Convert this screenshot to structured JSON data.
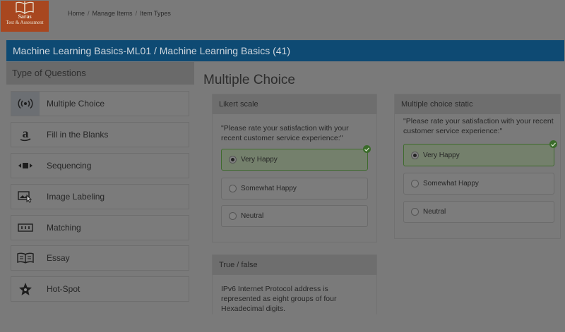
{
  "logo": {
    "line1": "Saras",
    "line2": "Test & Assessment"
  },
  "breadcrumb": [
    "Home",
    "Manage Items",
    "Item Types"
  ],
  "title_bar": "Machine Learning Basics-ML01 / Machine Learning Basics (41)",
  "sidebar": {
    "header": "Type of Questions",
    "items": [
      {
        "label": "Multiple Choice",
        "icon": "radio-signal-icon"
      },
      {
        "label": "Fill in the Blanks",
        "icon": "letter-a-icon"
      },
      {
        "label": "Sequencing",
        "icon": "sequence-arrows-icon"
      },
      {
        "label": "Image Labeling",
        "icon": "image-pointer-icon"
      },
      {
        "label": "Matching",
        "icon": "matching-icon"
      },
      {
        "label": "Essay",
        "icon": "open-book-icon"
      },
      {
        "label": "Hot-Spot",
        "icon": "hotspot-star-icon"
      }
    ]
  },
  "main": {
    "title": "Multiple Choice",
    "cards": {
      "likert": {
        "header": "Likert scale",
        "question": "\"Please rate your satisfaction with your recent customer service experience:\"",
        "options": [
          "Very Happy",
          "Somewhat Happy",
          "Neutral"
        ],
        "selected": "Very Happy"
      },
      "static": {
        "header": "Multiple choice static",
        "question": "\"Please rate your satisfaction with your recent customer service experience:\"",
        "options": [
          "Very Happy",
          "Somewhat Happy",
          "Neutral"
        ],
        "selected": "Very Happy"
      },
      "truefalse": {
        "header": "True / false",
        "question": "IPv6 Internet Protocol address is represented as eight groups of four Hexadecimal digits."
      }
    }
  },
  "colors": {
    "title_bar": "#0e4a73",
    "logo": "#a8471f",
    "selected_border": "#3f6a2e"
  }
}
